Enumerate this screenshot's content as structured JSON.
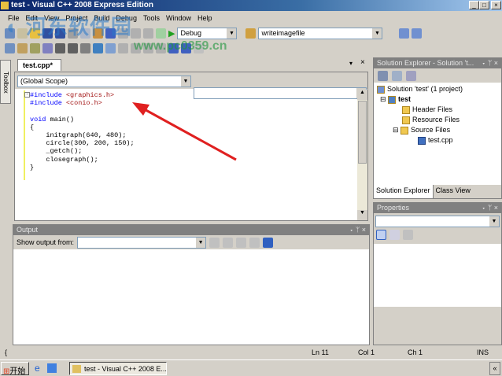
{
  "window": {
    "title": "test - Visual C++ 2008 Express Edition",
    "controls": [
      "_",
      "□",
      "×"
    ]
  },
  "watermark": {
    "text": "河东软件园",
    "url": "www.pc0359.cn"
  },
  "menu": [
    "File",
    "Edit",
    "View",
    "Project",
    "Build",
    "Debug",
    "Tools",
    "Window",
    "Help"
  ],
  "toolbar": {
    "config": "Debug",
    "target": "writeimagefile"
  },
  "editor": {
    "tab": "test.cpp*",
    "scope": "(Global Scope)",
    "member": "",
    "lines": [
      {
        "kw": "#include",
        "rest": " <graphics.h>"
      },
      {
        "kw": "#include",
        "rest": " <conio.h>"
      },
      {
        "kw": "",
        "rest": ""
      },
      {
        "kw": "void",
        "rest": " main()"
      },
      {
        "kw": "",
        "rest": "{"
      },
      {
        "kw": "",
        "rest": "    initgraph(640, 480);"
      },
      {
        "kw": "",
        "rest": "    circle(300, 200, 150);"
      },
      {
        "kw": "",
        "rest": "    _getch();"
      },
      {
        "kw": "",
        "rest": "    closegraph();"
      },
      {
        "kw": "",
        "rest": "}"
      }
    ]
  },
  "toolbox": {
    "label": "Toolbox"
  },
  "output": {
    "title": "Output",
    "show_label": "Show output from:",
    "source": ""
  },
  "solution_explorer": {
    "title": "Solution Explorer - Solution 't...",
    "solution": "Solution 'test' (1 project)",
    "project": "test",
    "folders": [
      "Header Files",
      "Resource Files",
      "Source Files"
    ],
    "file": "test.cpp",
    "tabs": [
      "Solution Explorer",
      "Class View"
    ]
  },
  "properties": {
    "title": "Properties"
  },
  "status": {
    "left": "{",
    "ln": "Ln 11",
    "col": "Col 1",
    "ch": "Ch 1",
    "mode": "INS"
  },
  "taskbar": {
    "start": "开始",
    "task": "test - Visual C++ 2008 E...",
    "tray": "«"
  }
}
